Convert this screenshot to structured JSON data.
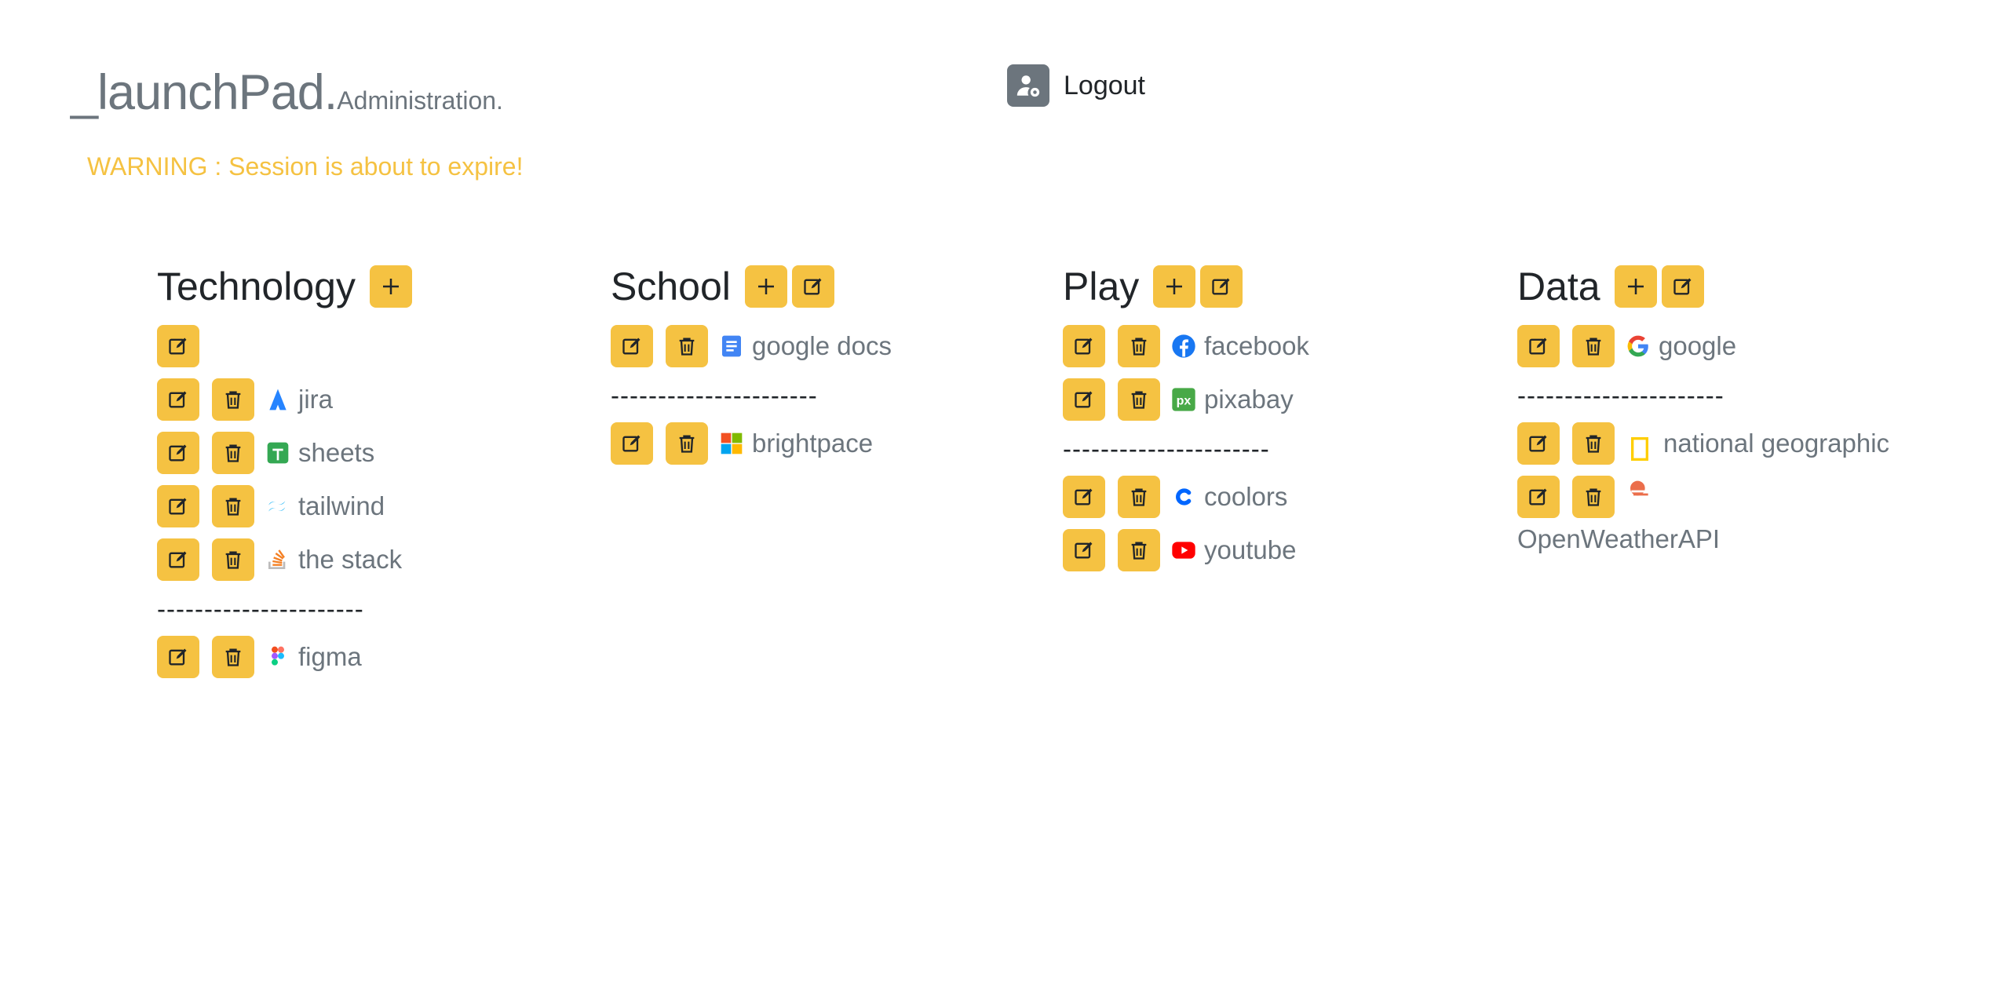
{
  "header": {
    "title": "_launchPad.",
    "subtitle": "Administration.",
    "warning": "WARNING : Session is about to expire!",
    "logout_label": "Logout"
  },
  "colors": {
    "accent": "#f5c242",
    "muted": "#6c757d",
    "text": "#212529"
  },
  "columns": [
    {
      "title": "Technology",
      "items": [
        {
          "label": "jira",
          "icon": "jira-icon"
        },
        {
          "label": "sheets",
          "icon": "sheets-icon"
        },
        {
          "label": "tailwind",
          "icon": "tailwind-icon"
        },
        {
          "label": "the stack",
          "icon": "stack-icon"
        },
        {
          "separator": "----------------------"
        },
        {
          "label": "figma",
          "icon": "figma-icon"
        }
      ]
    },
    {
      "title": "School",
      "items": [
        {
          "label": "google docs",
          "icon": "google-docs-icon"
        },
        {
          "separator": "----------------------"
        },
        {
          "label": "brightpace",
          "icon": "microsoft-icon"
        }
      ]
    },
    {
      "title": "Play",
      "items": [
        {
          "label": "facebook",
          "icon": "facebook-icon"
        },
        {
          "label": "pixabay",
          "icon": "pixabay-icon"
        },
        {
          "separator": "----------------------"
        },
        {
          "label": "coolors",
          "icon": "coolors-icon"
        },
        {
          "label": "youtube",
          "icon": "youtube-icon"
        }
      ]
    },
    {
      "title": "Data",
      "items": [
        {
          "label": "google",
          "icon": "google-icon"
        },
        {
          "separator": "----------------------"
        },
        {
          "label": "national geographic",
          "icon": "natgeo-icon"
        },
        {
          "label": "OpenWeatherAPI",
          "icon": "openweather-icon"
        }
      ]
    }
  ]
}
